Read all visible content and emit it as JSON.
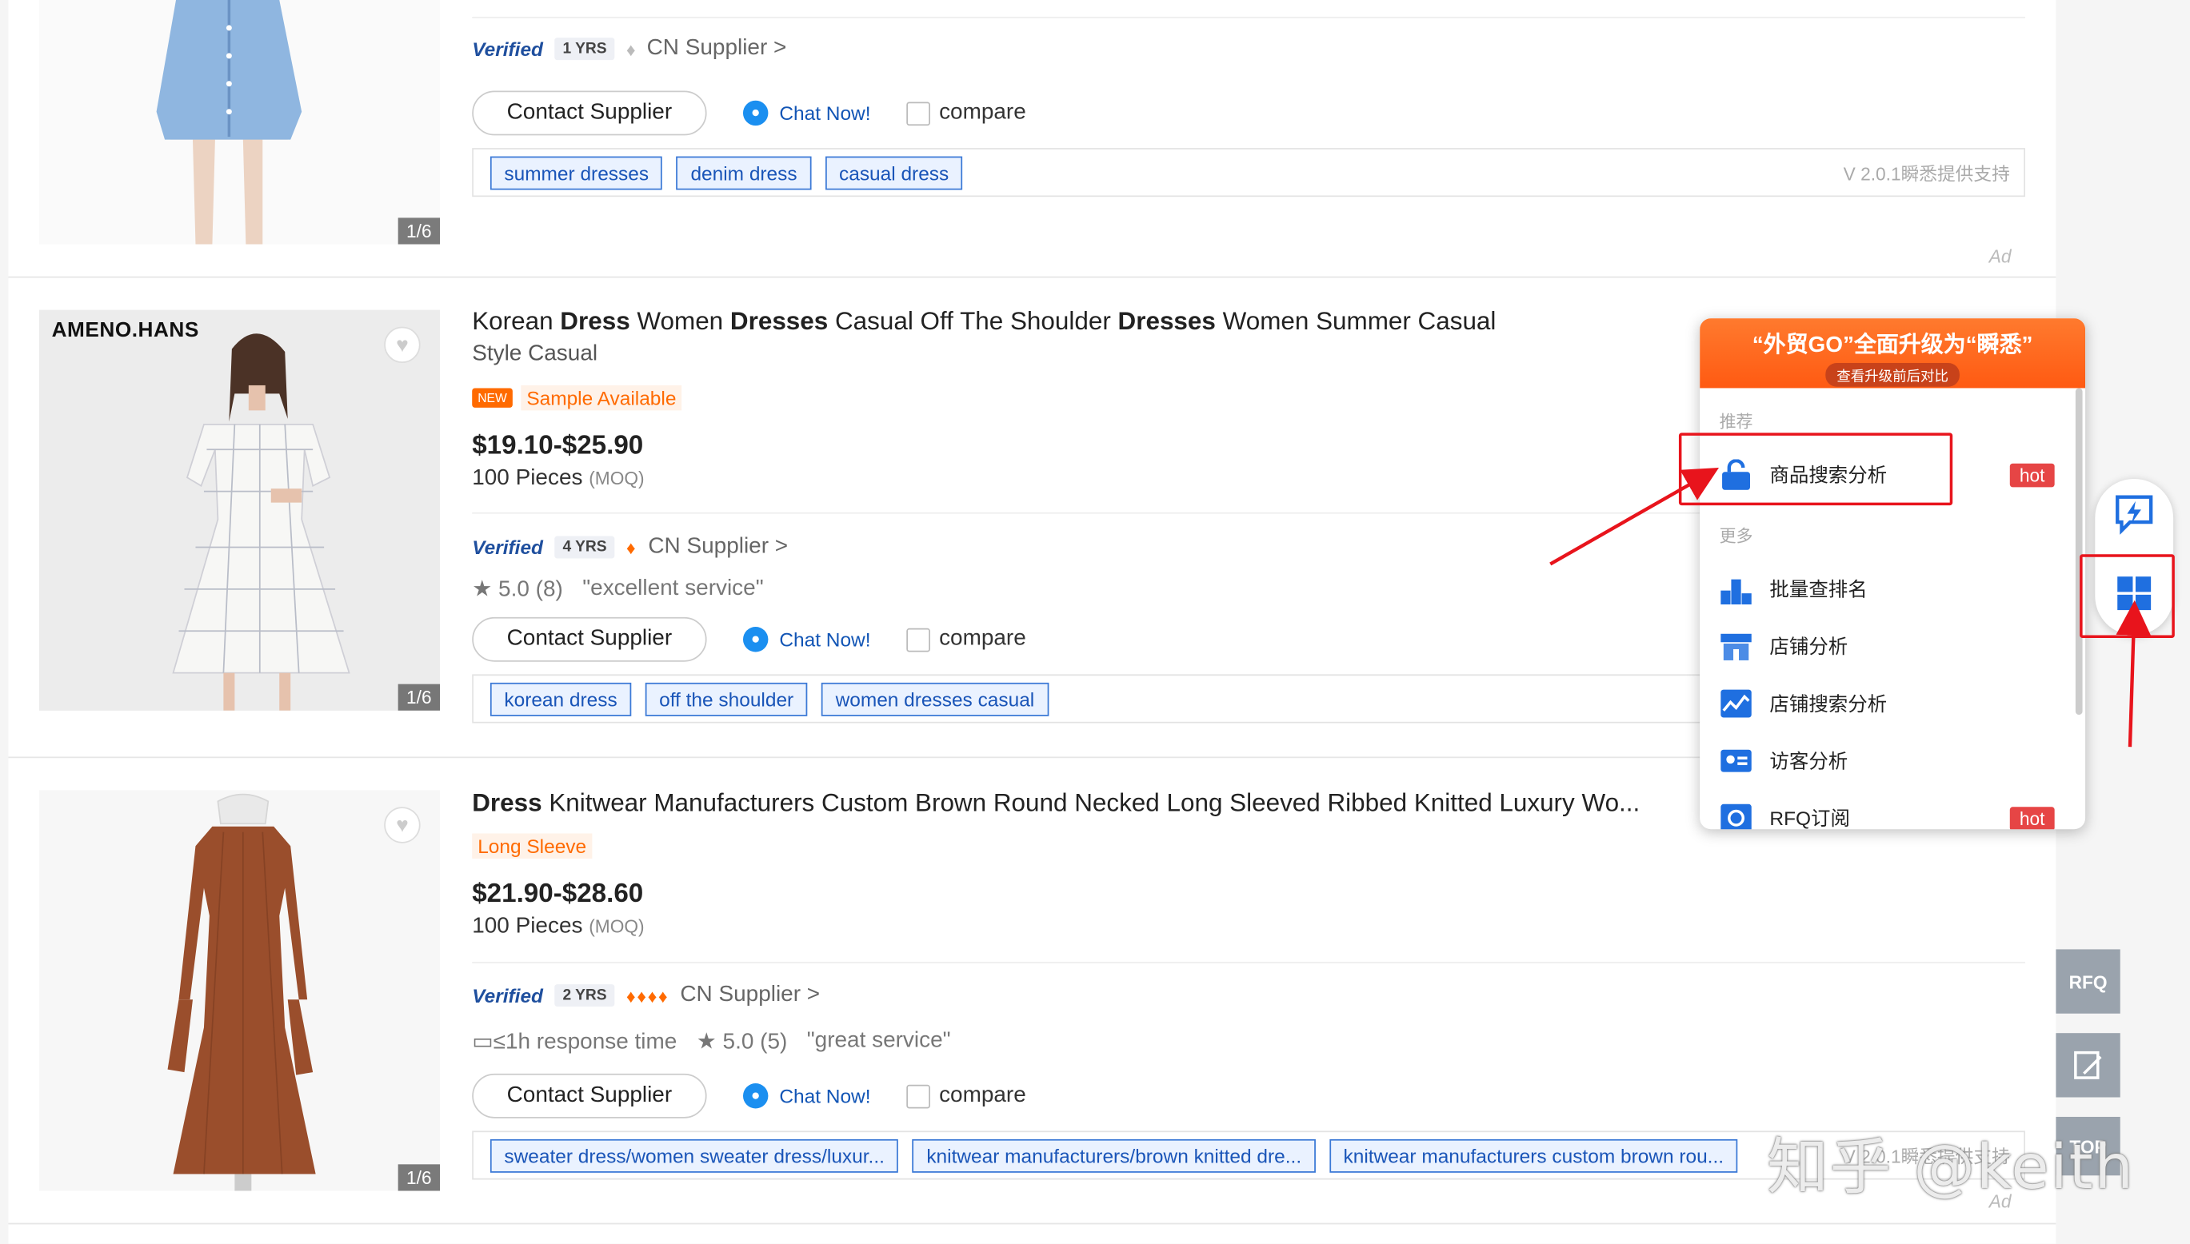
{
  "products": [
    {
      "image_count": "1/6",
      "verified": "Verified",
      "years": "1 YRS",
      "supplier": "CN Supplier >",
      "contact": "Contact Supplier",
      "chat": "Chat Now!",
      "compare": "compare",
      "keywords": [
        "summer dresses",
        "denim dress",
        "casual dress"
      ],
      "support": "V 2.0.1瞬悉提供支持",
      "ad": "Ad"
    },
    {
      "brand": "AMENO.HANS",
      "image_count": "1/6",
      "title_parts": [
        "Korean ",
        "Dress",
        " Women ",
        "Dresses",
        " Casual Off The Shoulder ",
        "Dresses",
        " Women Summer Casual"
      ],
      "title_bold": [
        false,
        true,
        false,
        true,
        false,
        true,
        false
      ],
      "subtitle": "Style Casual",
      "new_badge": "NEW",
      "tag": "Sample Available",
      "price": "$19.10-$25.90",
      "moq_qty": "100 Pieces",
      "moq_label": "(MOQ)",
      "verified": "Verified",
      "years": "4 YRS",
      "supplier": "CN Supplier >",
      "rating": "5.0 (8)",
      "review": "\"excellent service\"",
      "contact": "Contact Supplier",
      "chat": "Chat Now!",
      "compare": "compare",
      "keywords": [
        "korean dress",
        "off the shoulder",
        "women dresses casual"
      ]
    },
    {
      "image_count": "1/6",
      "title_parts": [
        "Dress",
        " Knitwear Manufacturers Custom Brown Round Necked Long Sleeved Ribbed Knitted Luxury Wo..."
      ],
      "title_bold": [
        true,
        false
      ],
      "tag": "Long Sleeve",
      "price": "$21.90-$28.60",
      "moq_qty": "100 Pieces",
      "moq_label": "(MOQ)",
      "verified": "Verified",
      "years": "2 YRS",
      "supplier": "CN Supplier >",
      "response": "≤1h response time",
      "rating": "5.0 (5)",
      "review": "\"great service\"",
      "contact": "Contact Supplier",
      "chat": "Chat Now!",
      "compare": "compare",
      "keywords": [
        "sweater dress/women sweater dress/luxur...",
        "knitwear manufacturers/brown knitted dre...",
        "knitwear manufacturers custom brown rou..."
      ],
      "support": "V 2.0.1瞬悉提供支持",
      "ad": "Ad"
    }
  ],
  "popup": {
    "banner_title": "“外贸GO”全面升级为“瞬悉”",
    "banner_button": "查看升级前后对比",
    "section_recommend": "推荐",
    "section_more": "更多",
    "items": [
      {
        "label": "商品搜索分析",
        "hot": "hot",
        "icon": "lock-search-icon"
      },
      {
        "label": "批量查排名",
        "icon": "ranking-icon"
      },
      {
        "label": "店铺分析",
        "icon": "store-icon"
      },
      {
        "label": "店铺搜索分析",
        "icon": "store-search-icon"
      },
      {
        "label": "访客分析",
        "icon": "visitor-icon"
      },
      {
        "label": "RFQ订阅",
        "hot": "hot",
        "icon": "rfq-icon"
      }
    ]
  },
  "sidebar": {
    "rfq": "RFQ",
    "top": "TOP"
  },
  "watermark": "知乎 @keith",
  "colors": {
    "accent": "#ff6a00",
    "link": "#1a55b8",
    "annotation": "#e8141c"
  }
}
